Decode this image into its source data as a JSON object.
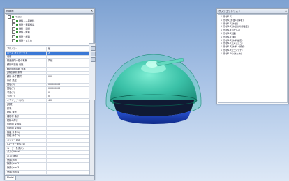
{
  "left_panel": {
    "title": "Model",
    "tree": [
      {
        "label": "Model",
        "depth": 0
      },
      {
        "label": "材料・一般材料",
        "depth": 1
      },
      {
        "label": "材料・表面構造",
        "depth": 1
      },
      {
        "label": "材料・溶接",
        "depth": 1
      },
      {
        "label": "材料・解析",
        "depth": 1
      },
      {
        "label": "材料・部品",
        "depth": 1
      },
      {
        "label": "材料・まとめ",
        "depth": 1
      }
    ],
    "properties": [
      {
        "name": "プロパティ",
        "value": "値"
      },
      {
        "name": "ボディ オブジェクト",
        "value": "名",
        "selected": true
      },
      {
        "name": "名前",
        "value": ""
      },
      {
        "name": "構造的同一性の有無",
        "value": "同種"
      },
      {
        "name": "解析時接続 有無",
        "value": ""
      },
      {
        "name": "解析時面接続 有無",
        "value": ""
      },
      {
        "name": "[詳細]解析条件",
        "value": ""
      },
      {
        "name": "解析 条件 要件",
        "value": "0.0"
      },
      {
        "name": "条件 設定",
        "value": ""
      },
      {
        "name": "回転(X)",
        "value": "0.0000000"
      },
      {
        "name": "回転(Y)",
        "value": "0.0000000"
      },
      {
        "name": "寸法(X)",
        "value": "0"
      },
      {
        "name": "寸法(Y)",
        "value": "0"
      },
      {
        "name": "オブジェクト(Z)",
        "value": "400"
      },
      {
        "name": "[材質]",
        "value": ""
      },
      {
        "name": "形状",
        "value": ""
      },
      {
        "name": "材料 番号",
        "value": ""
      },
      {
        "name": "補助材 番号",
        "value": ""
      },
      {
        "name": "材料の厚さ",
        "value": ""
      },
      {
        "name": "Signal 変数(1)",
        "value": ""
      },
      {
        "name": "Signal 変数(2)",
        "value": ""
      },
      {
        "name": "接触 条件(1)",
        "value": ""
      },
      {
        "name": "接触 条件(2)",
        "value": ""
      },
      {
        "name": "メッシュ設定",
        "value": ""
      },
      {
        "name": "[ユーザー条件](1)",
        "value": ""
      },
      {
        "name": "ユーザー条件(2)",
        "value": ""
      },
      {
        "name": "パス(Virtual)",
        "value": ""
      },
      {
        "name": "パス(Real)",
        "value": ""
      },
      {
        "name": "外部(mm)",
        "value": ""
      },
      {
        "name": "外部(mm)2",
        "value": ""
      },
      {
        "name": "外部(mm)3",
        "value": ""
      },
      {
        "name": "外部(mm)4",
        "value": ""
      }
    ],
    "status_tab": "Model",
    "status_text": "Info"
  },
  "right_panel": {
    "title": "オブジェクトリスト",
    "items": [
      "1 (形状1-1)",
      "1 (形状1)(外部1)(解析)",
      "1 (形状1-2)(材質)",
      "1 (形状1-2)(材質)(外部設定)",
      "1 (形状1-3)(ボディ)",
      "1 (形状1-4)(面)",
      "1 (形状1-5)(線)",
      "1 (形状1-6)(材料設定)",
      "1 (形状1-7)(メッシュ)",
      "1 (形状1-8)(材料・解析)",
      "1 (形状1-9)(コンテナ)",
      "1 (形状1-10)(まとめ)"
    ]
  },
  "viewport": {
    "dome_color": "#2ec0a0",
    "band_color": "#1b3fb0",
    "base_color": "#101a33"
  }
}
